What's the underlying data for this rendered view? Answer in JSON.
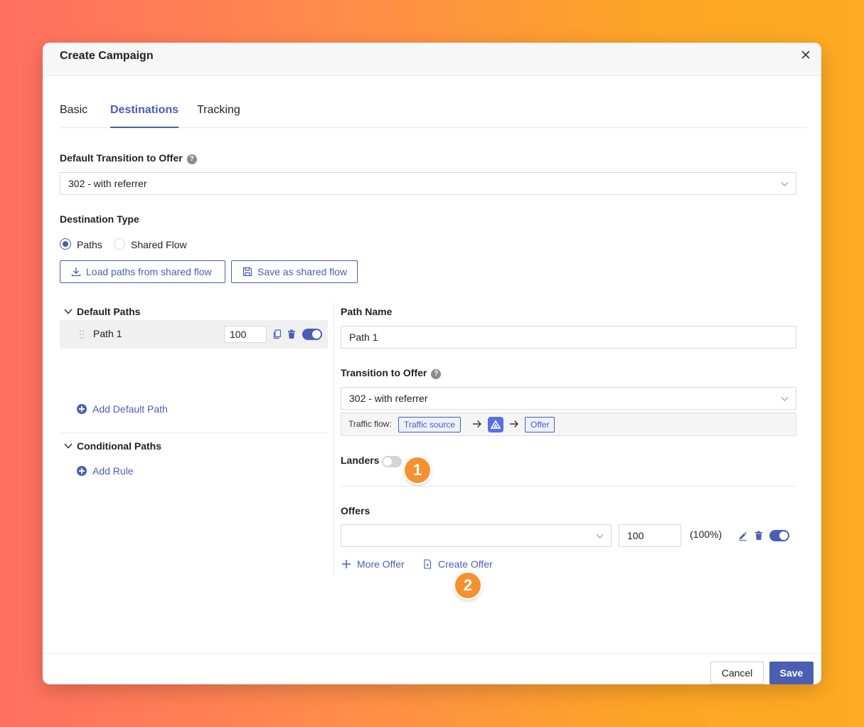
{
  "modal": {
    "title": "Create Campaign"
  },
  "tabs": [
    {
      "label": "Basic",
      "active": false
    },
    {
      "label": "Destinations",
      "active": true
    },
    {
      "label": "Tracking",
      "active": false
    }
  ],
  "default_transition": {
    "label": "Default Transition to Offer",
    "help": "?",
    "value": "302 - with referrer"
  },
  "destination_type": {
    "label": "Destination Type",
    "options": [
      {
        "label": "Paths",
        "checked": true
      },
      {
        "label": "Shared Flow",
        "checked": false
      }
    ]
  },
  "actions": {
    "load_label": "Load paths from shared flow",
    "save_shared_label": "Save as shared flow"
  },
  "default_paths": {
    "header": "Default Paths",
    "items": [
      {
        "name": "Path 1",
        "weight": "100",
        "enabled": true
      }
    ],
    "add_label": "Add Default Path"
  },
  "conditional_paths": {
    "header": "Conditional Paths",
    "add_label": "Add Rule"
  },
  "path_detail": {
    "name_label": "Path Name",
    "name_value": "Path 1",
    "transition_label": "Transition to Offer",
    "transition_help": "?",
    "transition_value": "302 - with referrer",
    "traffic_flow": {
      "label": "Traffic flow:",
      "source": "Traffic source",
      "offer": "Offer"
    },
    "landers_label": "Landers",
    "landers_enabled": false,
    "offers_label": "Offers",
    "offer_row": {
      "value": "",
      "weight": "100",
      "percent": "(100%)",
      "enabled": true
    },
    "more_offer_label": "More Offer",
    "create_offer_label": "Create Offer"
  },
  "badges": {
    "one": "1",
    "two": "2"
  },
  "footer": {
    "cancel_label": "Cancel",
    "save_label": "Save"
  },
  "colors": {
    "accent": "#4a5fb3",
    "badge": "#f5922f",
    "gradient_start": "#ff6f61",
    "gradient_end": "#fdab22"
  }
}
